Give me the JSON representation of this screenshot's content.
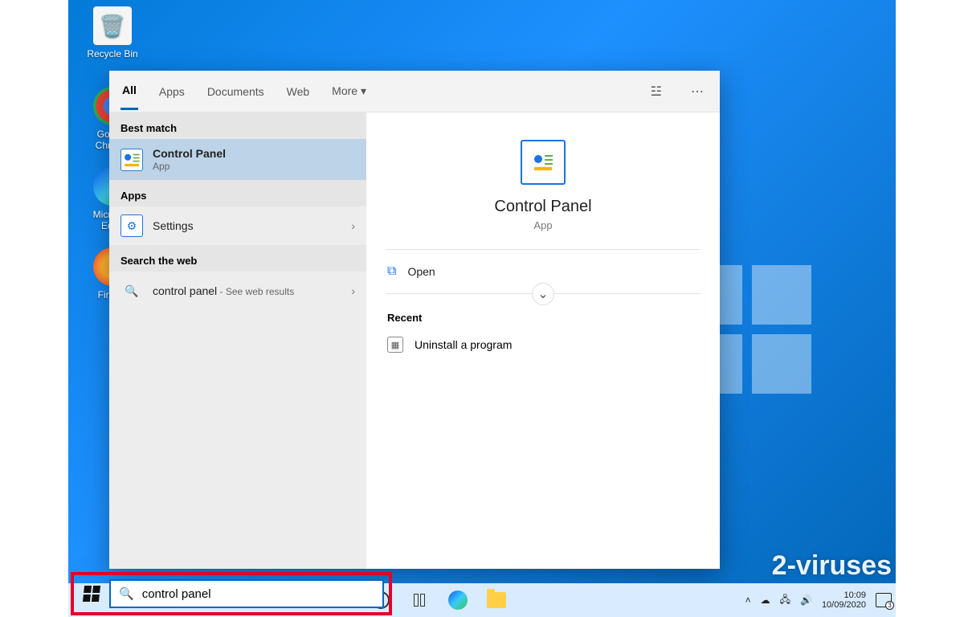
{
  "desktop_icons": {
    "recycle": "Recycle Bin",
    "chrome": "Google Chrome",
    "edge": "Microsoft Edge",
    "firefox": "Firefox"
  },
  "search": {
    "tabs": {
      "all": "All",
      "apps": "Apps",
      "documents": "Documents",
      "web": "Web",
      "more": "More"
    },
    "sections": {
      "best": "Best match",
      "apps": "Apps",
      "web": "Search the web"
    },
    "best": {
      "title": "Control Panel",
      "sub": "App"
    },
    "apps_row": {
      "title": "Settings"
    },
    "web_row": {
      "title": "control panel",
      "sub": " - See web results"
    },
    "detail": {
      "title": "Control Panel",
      "sub": "App",
      "open": "Open",
      "recent_h": "Recent",
      "recent_item": "Uninstall a program"
    }
  },
  "taskbar": {
    "search_value": "control panel",
    "clock": {
      "time": "10:09",
      "date": "10/09/2020"
    },
    "notif_count": "3"
  },
  "watermark": "2-viruses"
}
